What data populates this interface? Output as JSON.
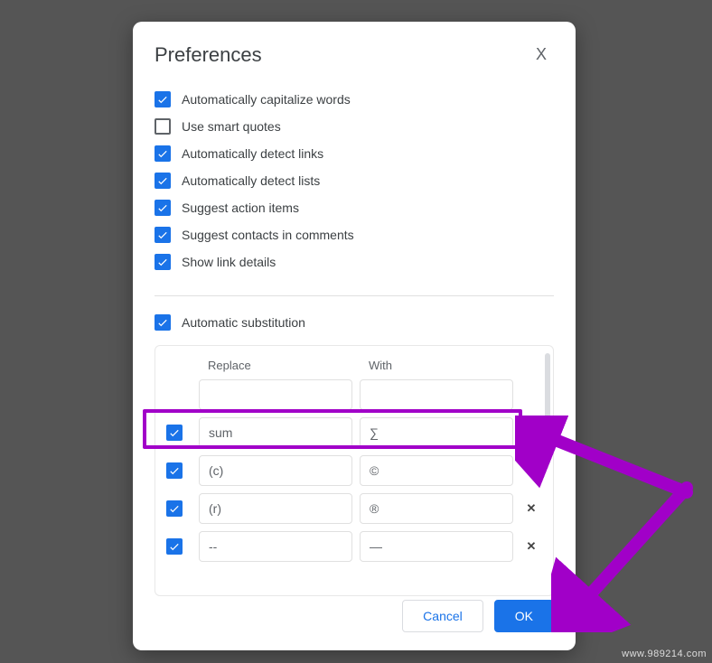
{
  "dialog": {
    "title": "Preferences",
    "close_icon": "X"
  },
  "options": [
    {
      "label": "Automatically capitalize words",
      "checked": true
    },
    {
      "label": "Use smart quotes",
      "checked": false
    },
    {
      "label": "Automatically detect links",
      "checked": true
    },
    {
      "label": "Automatically detect lists",
      "checked": true
    },
    {
      "label": "Suggest action items",
      "checked": true
    },
    {
      "label": "Suggest contacts in comments",
      "checked": true
    },
    {
      "label": "Show link details",
      "checked": true
    }
  ],
  "auto_sub": {
    "label": "Automatic substitution",
    "checked": true,
    "columns": {
      "replace": "Replace",
      "with": "With"
    },
    "new_row": {
      "replace": "",
      "with": ""
    },
    "rows": [
      {
        "checked": true,
        "replace": "sum",
        "with": "∑"
      },
      {
        "checked": true,
        "replace": "(c)",
        "with": "©"
      },
      {
        "checked": true,
        "replace": "(r)",
        "with": "®"
      },
      {
        "checked": true,
        "replace": "--",
        "with": "—"
      }
    ],
    "delete_glyph": "✕"
  },
  "footer": {
    "cancel": "Cancel",
    "ok": "OK"
  },
  "watermark": "www.989214.com",
  "colors": {
    "accent": "#1a73e8",
    "highlight": "#a100c8"
  }
}
